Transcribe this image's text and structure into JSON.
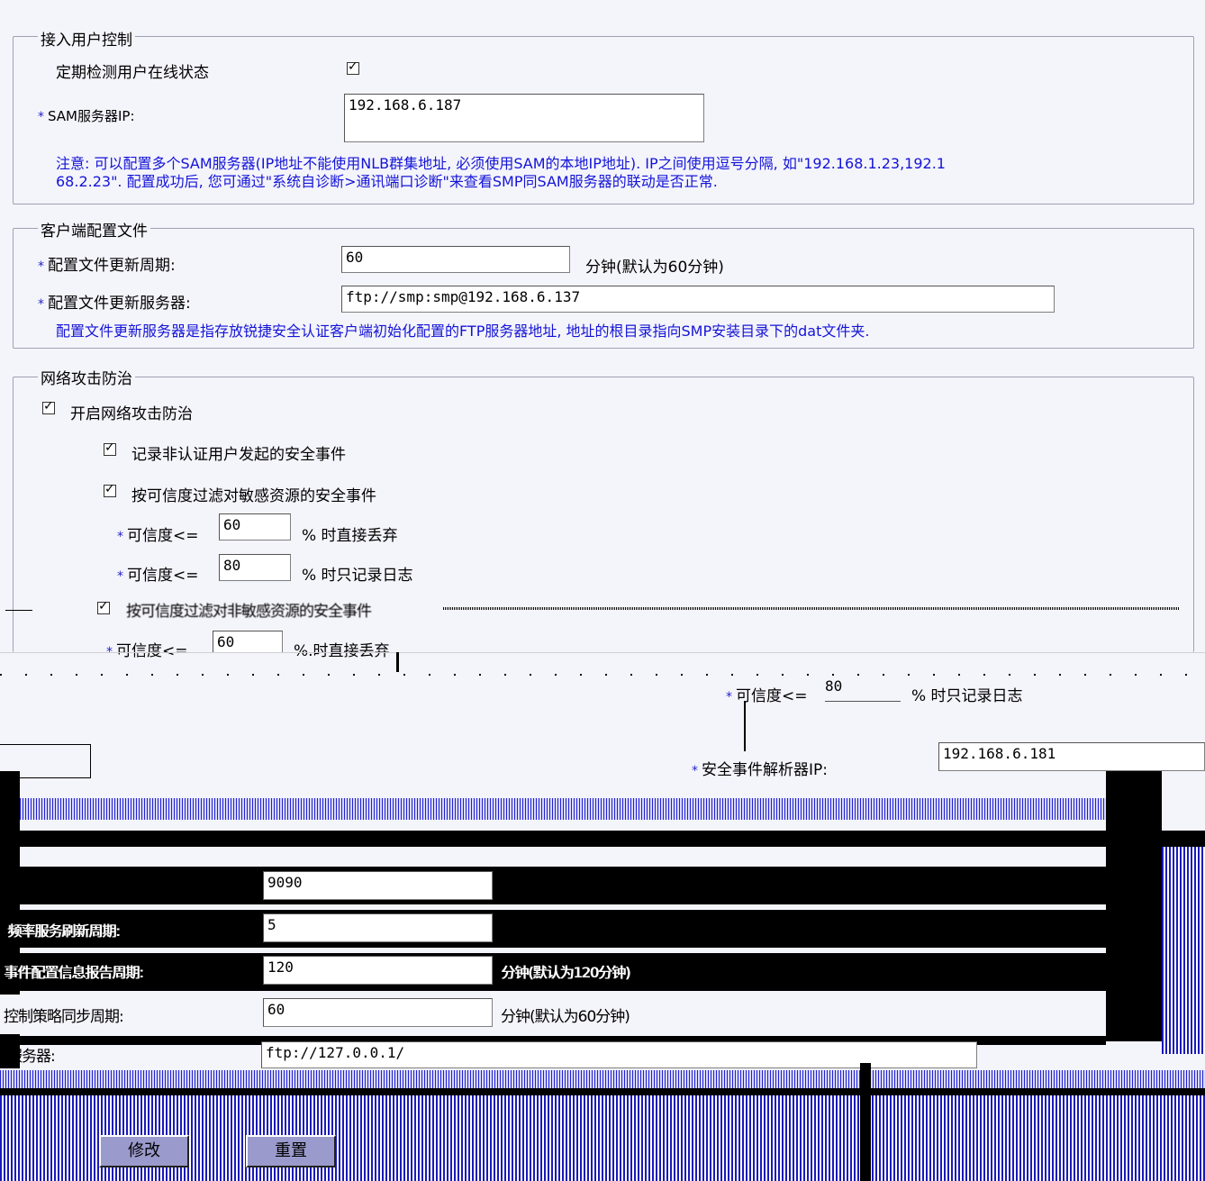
{
  "access": {
    "legend": "接入用户控制",
    "online_check_label": "定期检测用户在线状态",
    "online_check_checked": true,
    "sam_ip_label": "SAM服务器IP:",
    "sam_ip_value": "192.168.6.187",
    "note_line1": "注意: 可以配置多个SAM服务器(IP地址不能使用NLB群集地址, 必须使用SAM的本地IP地址). IP之间使用逗号分隔, 如\"192.168.1.23,192.1",
    "note_line2": "68.2.23\". 配置成功后, 您可通过\"系统自诊断>通讯端口诊断\"来查看SMP同SAM服务器的联动是否正常."
  },
  "client": {
    "legend": "客户端配置文件",
    "period_label": "配置文件更新周期:",
    "period_value": "60",
    "period_unit": "分钟(默认为60分钟)",
    "server_label": "配置文件更新服务器:",
    "server_value": "ftp://smp:smp@192.168.6.137",
    "note": "配置文件更新服务器是指存放锐捷安全认证客户端初始化配置的FTP服务器地址, 地址的根目录指向SMP安装目录下的dat文件夹."
  },
  "attack": {
    "legend": "网络攻击防治",
    "enable_label": "开启网络攻击防治",
    "record_unauth_label": "记录非认证用户发起的安全事件",
    "filter_sensitive_label": "按可信度过滤对敏感资源的安全事件",
    "cred_label": "可信度<=",
    "cred_drop_value": "60",
    "cred_drop_suffix": "% 时直接丢弃",
    "cred_log_value": "80",
    "cred_log_suffix": "% 时只记录日志",
    "filter_nonsensitive_label": "按可信度过滤对非敏感资源的安全事件",
    "ns_drop_value": "60",
    "ns_drop_suffix": "%.时直接丢弃",
    "ns_log_value": "80",
    "ns_log_suffix": "% 时只记录日志",
    "parser_ip_label": "安全事件解析器IP:",
    "parser_ip_value": "192.168.6.181"
  },
  "other": {
    "row1_value": "9090",
    "row2_label": "频率服务刷新周期:",
    "row2_value": "5",
    "row3_label": "事件配置信息报告周期:",
    "row3_value": "120",
    "row3_unit": "分钟(默认为120分钟)",
    "row4_label": "控制策略同步周期:",
    "row4_value": "60",
    "row4_unit": "分钟(默认为60分钟)",
    "row5_label": "服务器:",
    "row5_value": "ftp://127.0.0.1/"
  },
  "buttons": {
    "modify": "修改",
    "reset": "重置"
  }
}
